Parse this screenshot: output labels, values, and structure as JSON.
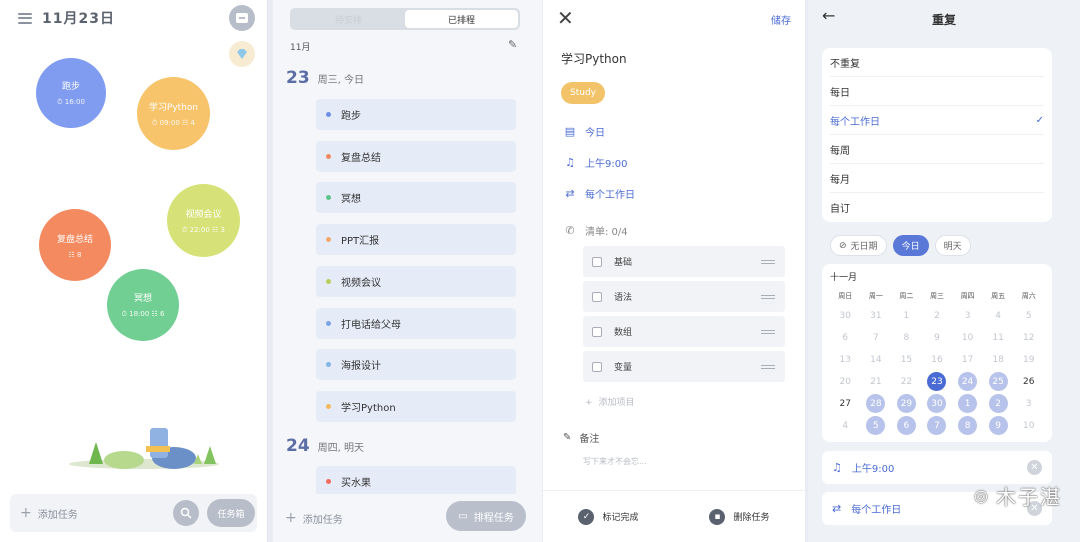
{
  "panel1": {
    "date": "11月23日",
    "bubbles": [
      {
        "title": "跑步",
        "meta": "⏱ 16:00",
        "color": "#7f9cf0"
      },
      {
        "title": "学习Python",
        "meta": "⏱ 09:00 ☷ 4",
        "color": "#f7c46b"
      },
      {
        "title": "视频会议",
        "meta": "⏱ 22:00 ☷ 3",
        "color": "#d6e277"
      },
      {
        "title": "复盘总结",
        "meta": "☷ 8",
        "color": "#f48a5f"
      },
      {
        "title": "冥想",
        "meta": "⏱ 18:00 ☷ 6",
        "color": "#72cf93"
      }
    ],
    "add_task": "添加任务",
    "task_box": "任务箱"
  },
  "panel2": {
    "tabs": [
      "待安排",
      "已排程"
    ],
    "month": "11月",
    "day1": {
      "num": "23",
      "label": "周三, 今日"
    },
    "day2": {
      "num": "24",
      "label": "周四, 明天"
    },
    "tasks": [
      {
        "label": "跑步",
        "color": "#6f8fe6"
      },
      {
        "label": "复盘总结",
        "color": "#f08a5d"
      },
      {
        "label": "冥想",
        "color": "#5ec48a"
      },
      {
        "label": "PPT汇报",
        "color": "#f3a86b"
      },
      {
        "label": "视频会议",
        "color": "#b9cf5a"
      },
      {
        "label": "打电话给父母",
        "color": "#7aa4e6"
      },
      {
        "label": "海报设计",
        "color": "#7fb6e6"
      },
      {
        "label": "学习Python",
        "color": "#f5b85a"
      }
    ],
    "tasks2": [
      {
        "label": "买水果",
        "color": "#f06a5d"
      }
    ],
    "add_task": "添加任务",
    "schedule": "排程任务"
  },
  "panel3": {
    "save": "储存",
    "title": "学习Python",
    "tag": "Study",
    "date": "今日",
    "reminder": "上午9:00",
    "repeat": "每个工作日",
    "checklist": "清单:  0/4",
    "items": [
      "基础",
      "语法",
      "数组",
      "变量"
    ],
    "add_item": "添加项目",
    "note": "备注",
    "note_placeholder": "写下来才不会忘...",
    "done": "标记完成",
    "delete": "删除任务"
  },
  "panel4": {
    "title": "重复",
    "options": [
      "不重复",
      "每日",
      "每个工作日",
      "每周",
      "每月",
      "自订"
    ],
    "selected": "每个工作日",
    "pills": [
      "无日期",
      "今日",
      "明天"
    ],
    "cal_month": "十一月",
    "weekdays": [
      "周日",
      "周一",
      "周二",
      "周三",
      "周四",
      "周五",
      "周六"
    ],
    "days": [
      [
        "30",
        "31",
        "1",
        "2",
        "3",
        "4",
        "5"
      ],
      [
        "6",
        "7",
        "8",
        "9",
        "10",
        "11",
        "12"
      ],
      [
        "13",
        "14",
        "15",
        "16",
        "17",
        "18",
        "19"
      ],
      [
        "20",
        "21",
        "22",
        "23",
        "24",
        "25",
        "26"
      ],
      [
        "27",
        "28",
        "29",
        "30",
        "1",
        "2",
        "3"
      ],
      [
        "4",
        "5",
        "6",
        "7",
        "8",
        "9",
        "10"
      ]
    ],
    "reminder": "上午9:00",
    "repeat": "每个工作日",
    "watermark": "木子湛"
  }
}
